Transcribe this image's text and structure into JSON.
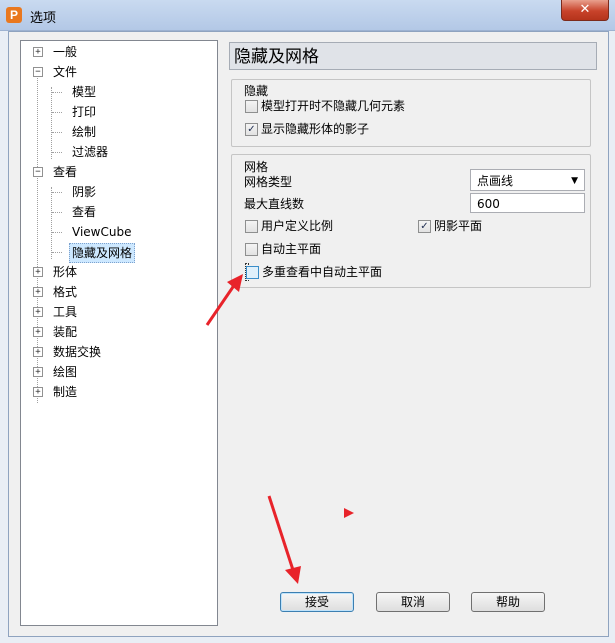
{
  "window": {
    "title": "选项",
    "app_icon_letter": "P",
    "close_glyph": "✕"
  },
  "tree": {
    "items": [
      {
        "label": "一般",
        "toggle": "+"
      },
      {
        "label": "文件",
        "toggle": "−"
      },
      {
        "label": "模型"
      },
      {
        "label": "打印"
      },
      {
        "label": "绘制"
      },
      {
        "label": "过滤器"
      },
      {
        "label": "查看",
        "toggle": "−"
      },
      {
        "label": "阴影"
      },
      {
        "label": "查看"
      },
      {
        "label": "ViewCube"
      },
      {
        "label": "隐藏及网格",
        "selected": true
      },
      {
        "label": "形体",
        "toggle": "+"
      },
      {
        "label": "格式",
        "toggle": "+"
      },
      {
        "label": "工具",
        "toggle": "+"
      },
      {
        "label": "装配",
        "toggle": "+"
      },
      {
        "label": "数据交换",
        "toggle": "+"
      },
      {
        "label": "绘图",
        "toggle": "+"
      },
      {
        "label": "制造",
        "toggle": "+"
      }
    ]
  },
  "panel": {
    "title": "隐藏及网格",
    "hide_group": {
      "title": "隐藏",
      "options": [
        {
          "label": "模型打开时不隐藏几何元素",
          "checked": false
        },
        {
          "label": "显示隐藏形体的影子",
          "checked": true
        }
      ]
    },
    "grid_group": {
      "title": "网格",
      "grid_type_label": "网格类型",
      "grid_type_value": "点画线",
      "max_lines_label": "最大直线数",
      "max_lines_value": "600",
      "user_scale": {
        "label": "用户定义比例",
        "checked": false
      },
      "shadow_plane": {
        "label": "阴影平面",
        "checked": true
      },
      "auto_plane": {
        "label": "自动主平面",
        "checked": false
      },
      "multi_auto_plane": {
        "label": "多重查看中自动主平面",
        "checked": false
      }
    }
  },
  "buttons": {
    "accept": "接受",
    "cancel": "取消",
    "help": "帮助"
  },
  "colors": {
    "annotation_arrow": "#e8232a"
  },
  "icons": {
    "check": "✓",
    "dropdown": "▼"
  }
}
